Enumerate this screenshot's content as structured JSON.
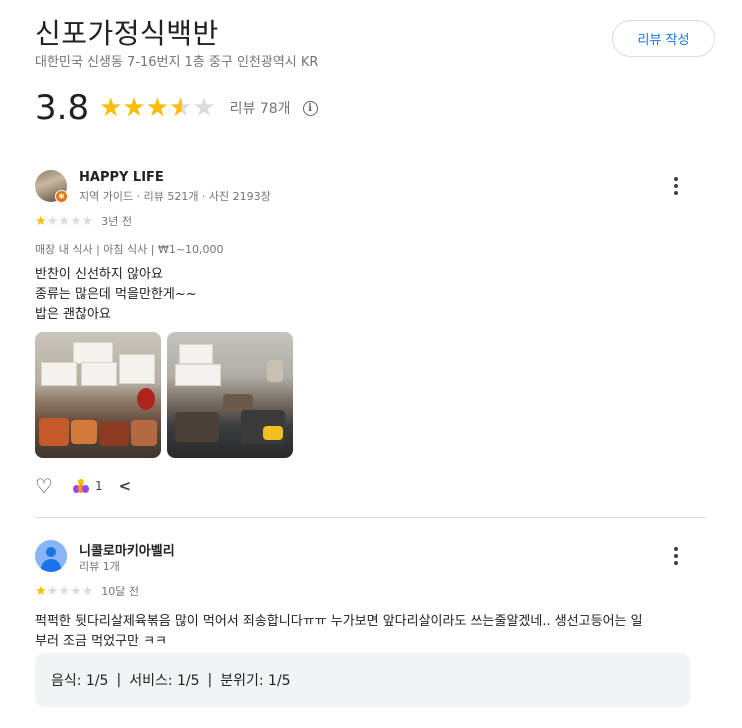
{
  "place": {
    "title": "신포가정식백반",
    "address": "대한민국 신생동 7-16번지 1층 중구 인천광역시 KR",
    "write_review_label": "리뷰 작성",
    "rating_value": "3.8",
    "rating_stars": 3.8,
    "review_count": "리뷰 78개",
    "info_icon": "info-icon"
  },
  "reviews": [
    {
      "name": "HAPPY LIFE",
      "meta": "지역 가이드 · 리뷰 521개 · 사진 2193장",
      "stars": 1,
      "date": "3년 전",
      "tags": "매장 내 식사 | 아침 식사 | ₩1~10,000",
      "text_lines": [
        "반찬이 신선하지 않아요",
        "종류는 많은데 먹을만한게~~",
        "밥은 괜찮아요"
      ],
      "like_count": "1",
      "icons": [
        "heart-icon",
        "like-emoji-icon",
        "share-icon",
        "more-vert-icon"
      ]
    },
    {
      "name": "니콜로마키아벨리",
      "meta": "리뷰 1개",
      "stars": 1,
      "date": "10달 전",
      "text_lines": [
        "퍽퍽한 뒷다리살제육볶음 많이 먹어서 죄송합니다ㅠㅠ 누가보면 앞다리살이라도 쓰는줄알겠네.. 생선고등어는 일",
        "부러 조금 먹었구만 ㅋㅋ"
      ],
      "service": {
        "food": "음식: 1/5",
        "service": "서비스: 1/5",
        "atmosphere": "분위기: 1/5",
        "separator": "|"
      }
    }
  ],
  "colors": {
    "star_on": "#fbbc04",
    "star_off": "#dadce0",
    "accent": "#1a73e8"
  }
}
